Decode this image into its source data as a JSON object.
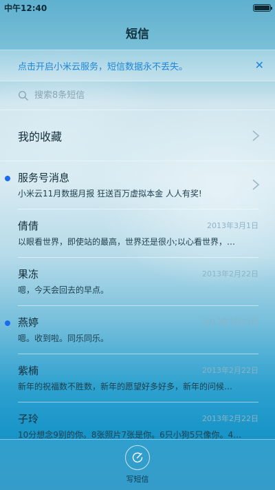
{
  "status_bar": {
    "time": "中午12:40"
  },
  "header": {
    "title": "短信"
  },
  "banner": {
    "text": "点击开启小米云服务，短信数据永不丢失。",
    "close_symbol": "✕"
  },
  "search": {
    "placeholder": "搜索8条短信"
  },
  "favorites": {
    "label": "我的收藏"
  },
  "messages": [
    {
      "sender": "服务号消息",
      "date": "",
      "preview": "小米云11月数据月报 狂送百万虚拟本金 人人有奖!",
      "unread": true,
      "has_chevron": true
    },
    {
      "sender": "倩倩",
      "date": "2013年3月1日",
      "preview": "以眼看世界，即使站的最高，世界还是很小;以心看世界，…",
      "unread": false,
      "has_chevron": false
    },
    {
      "sender": "果冻",
      "date": "2013年2月22日",
      "preview": "嗯，今天会回去的早点。",
      "unread": false,
      "has_chevron": false
    },
    {
      "sender": "燕婷",
      "date": "2013年2月22日",
      "preview": "嗯。收到啦。同乐同乐。",
      "unread": true,
      "has_chevron": false
    },
    {
      "sender": "紫楠",
      "date": "2013年2月22日",
      "preview": "新年的祝福数不胜数，新年的愿望好多好多，新年的问候…",
      "unread": false,
      "has_chevron": false
    },
    {
      "sender": "子玲",
      "date": "2013年2月22日",
      "preview": "10分想念9别的你。8张照片7张是你。6只小狗5只像你。4…",
      "unread": false,
      "has_chevron": false
    }
  ],
  "bottom_bar": {
    "compose_label": "写短信"
  },
  "colors": {
    "accent": "#1f86d8",
    "unread_dot": "#1b6bf0"
  },
  "icons": {
    "search": "search-icon",
    "chevron": "chevron-right-icon",
    "compose": "compose-icon",
    "close": "close-icon",
    "battery": "battery-icon"
  }
}
